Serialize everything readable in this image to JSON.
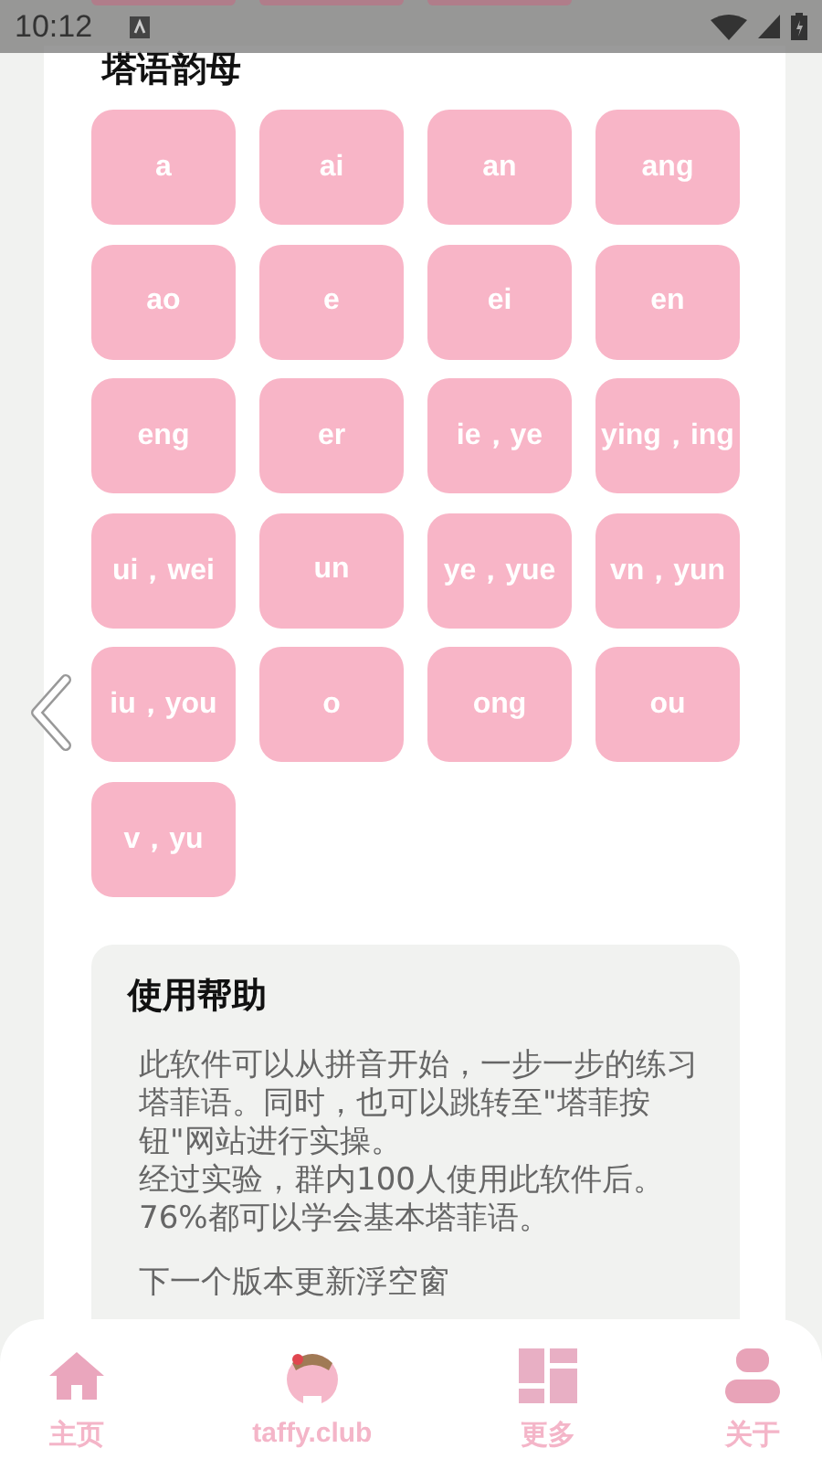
{
  "status_bar": {
    "time": "10:12"
  },
  "section_title": "塔语韵母",
  "finals": [
    "a",
    "ai",
    "an",
    "ang",
    "ao",
    "e",
    "ei",
    "en",
    "eng",
    "er",
    "ie，ye",
    "ying，ing",
    "ui，wei",
    "un",
    "ye，yue",
    "vn，yun",
    "iu，you",
    "o",
    "ong",
    "ou",
    "v，yu"
  ],
  "help": {
    "title": "使用帮助",
    "lines": [
      "此软件可以从拼音开始，一步一步的练习塔菲语。同时，也可以跳转至\"塔菲按钮\"网站进行实操。",
      "经过实验，群内100人使用此软件后。",
      "76%都可以学会基本塔菲语。"
    ],
    "note": "下一个版本更新浮空窗"
  },
  "bottom_nav": [
    {
      "kind": "home",
      "label": "主页"
    },
    {
      "kind": "avatar",
      "label": "taffy.club"
    },
    {
      "kind": "grid",
      "label": "更多"
    },
    {
      "kind": "person",
      "label": "关于"
    }
  ]
}
